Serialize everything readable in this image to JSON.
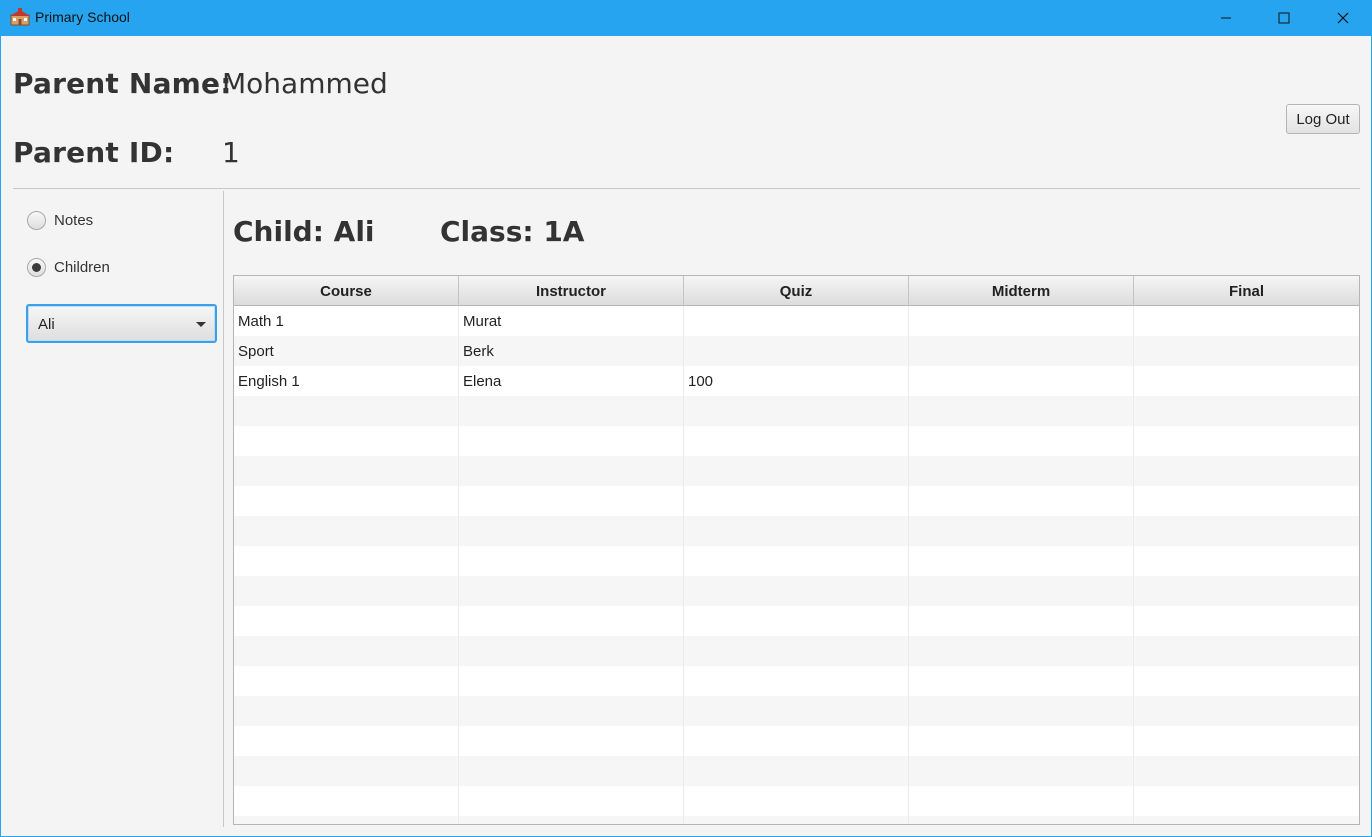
{
  "window": {
    "title": "Primary School",
    "icon": "school-building-icon",
    "controls": [
      "minimize-icon",
      "maximize-icon",
      "close-icon"
    ],
    "accent_color": "#27a4f0"
  },
  "header": {
    "parent_name_label": "Parent Name:",
    "parent_name_value": "Mohammed",
    "parent_id_label": "Parent ID:",
    "parent_id_value": "1",
    "logout_label": "Log Out"
  },
  "sidebar": {
    "options": [
      {
        "label": "Notes",
        "checked": false
      },
      {
        "label": "Children",
        "checked": true
      }
    ],
    "child_select": {
      "value": "Ali"
    }
  },
  "main": {
    "child_label": "Child: Ali",
    "class_label": "Class: 1A",
    "table": {
      "columns": [
        "Course",
        "Instructor",
        "Quiz",
        "Midterm",
        "Final"
      ],
      "rows": [
        [
          "Math 1",
          "Murat",
          "",
          "",
          ""
        ],
        [
          "Sport",
          "Berk",
          "",
          "",
          ""
        ],
        [
          "English 1",
          "Elena",
          "100",
          "",
          ""
        ]
      ],
      "empty_rows": 15
    }
  }
}
